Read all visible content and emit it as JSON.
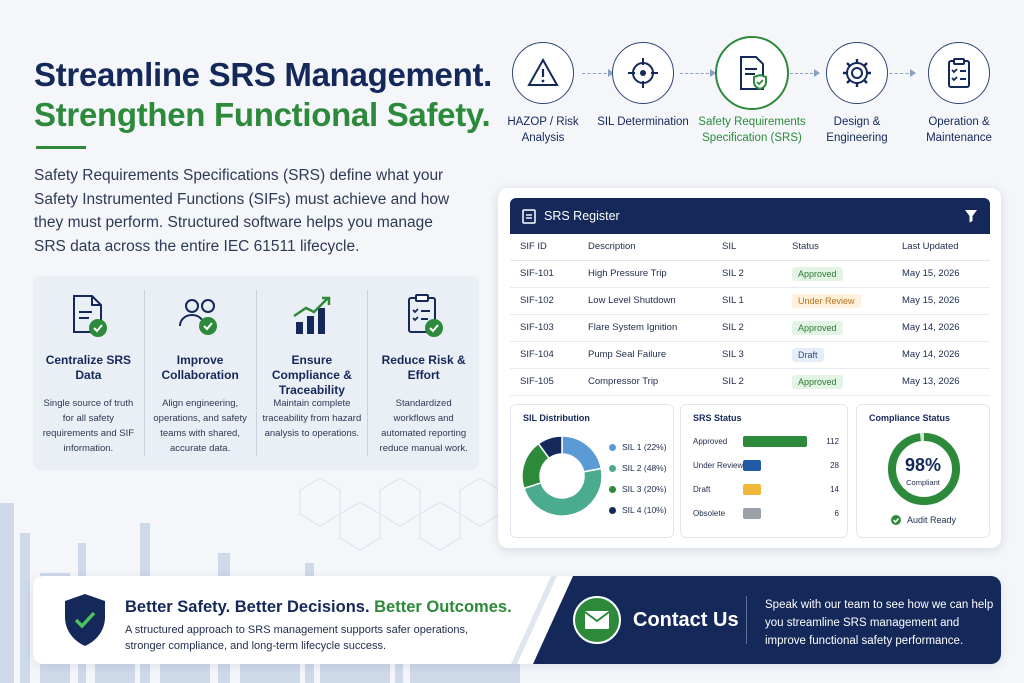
{
  "headline": {
    "line1": "Streamline SRS Management.",
    "line2": "Strengthen Functional Safety."
  },
  "intro": "Safety Requirements Specifications (SRS) define what your Safety Instrumented Functions (SIFs) must achieve and how they must perform. Structured software helps you manage SRS data across the entire IEC 61511 lifecycle.",
  "benefits": [
    {
      "icon": "document-check-icon",
      "title": "Centralize SRS Data",
      "desc": "Single source of truth for all safety requirements and SIF information."
    },
    {
      "icon": "team-check-icon",
      "title": "Improve Collaboration",
      "desc": "Align engineering, operations, and safety teams with shared, accurate data."
    },
    {
      "icon": "growth-chart-icon",
      "title": "Ensure Compliance & Traceability",
      "desc": "Maintain complete traceability from hazard analysis to operations."
    },
    {
      "icon": "checklist-icon",
      "title": "Reduce Risk & Effort",
      "desc": "Standardized workflows and automated reporting reduce manual work."
    }
  ],
  "process": [
    {
      "icon": "warning-icon",
      "label": "HAZOP / Risk Analysis",
      "active": false
    },
    {
      "icon": "target-icon",
      "label": "SIL Determination",
      "active": false
    },
    {
      "icon": "document-shield-icon",
      "label": "Safety Requirements Specification (SRS)",
      "active": true
    },
    {
      "icon": "gear-icon",
      "label": "Design & Engineering",
      "active": false
    },
    {
      "icon": "clipboard-check-icon",
      "label": "Operation & Maintenance",
      "active": false
    }
  ],
  "register": {
    "title": "SRS Register",
    "columns": [
      "SIF ID",
      "Description",
      "SIL",
      "Status",
      "Last Updated"
    ],
    "rows": [
      {
        "id": "SIF-101",
        "desc": "High Pressure Trip",
        "sil": "SIL 2",
        "status": "Approved",
        "updated": "May 15, 2026"
      },
      {
        "id": "SIF-102",
        "desc": "Low Level Shutdown",
        "sil": "SIL 1",
        "status": "Under Review",
        "updated": "May 15, 2026"
      },
      {
        "id": "SIF-103",
        "desc": "Flare System Ignition",
        "sil": "SIL 2",
        "status": "Approved",
        "updated": "May 14, 2026"
      },
      {
        "id": "SIF-104",
        "desc": "Pump Seal Failure",
        "sil": "SIL 3",
        "status": "Draft",
        "updated": "May 14, 2026"
      },
      {
        "id": "SIF-105",
        "desc": "Compressor Trip",
        "sil": "SIL 2",
        "status": "Approved",
        "updated": "May 13, 2026"
      }
    ]
  },
  "sil_distribution": {
    "title": "SIL Distribution",
    "legend": [
      "SIL 1 (22%)",
      "SIL 2 (48%)",
      "SIL 3 (20%)",
      "SIL 4 (10%)"
    ]
  },
  "srs_status": {
    "title": "SRS Status"
  },
  "compliance": {
    "title": "Compliance Status",
    "value": "98%",
    "value_num": 98,
    "label": "Compliant",
    "audit": "Audit Ready",
    "color": "#2c8a3a"
  },
  "chart_data": [
    {
      "type": "pie",
      "title": "SIL Distribution",
      "categories": [
        "SIL 1",
        "SIL 2",
        "SIL 3",
        "SIL 4"
      ],
      "values": [
        22,
        48,
        20,
        10
      ],
      "colors": [
        "#5a9bd5",
        "#4bab8e",
        "#2c8a3a",
        "#14285a"
      ]
    },
    {
      "type": "bar",
      "title": "SRS Status",
      "categories": [
        "Approved",
        "Under Review",
        "Draft",
        "Obsolete"
      ],
      "values": [
        112,
        28,
        14,
        6
      ],
      "colors": [
        "#2c8a3a",
        "#1f5aa6",
        "#f0b73a",
        "#9aa0a8"
      ]
    }
  ],
  "banner": {
    "title_part1": "Better Safety. Better Decisions.",
    "title_part2": "Better Outcomes.",
    "desc": "A structured approach to SRS management supports safer operations, stronger compliance, and long-term lifecycle success.",
    "contact_label": "Contact Us",
    "contact_text": "Speak with our team to see how we can help you streamline SRS management and improve functional safety performance."
  },
  "colors": {
    "navy": "#14285a",
    "green": "#2c8a3a"
  }
}
